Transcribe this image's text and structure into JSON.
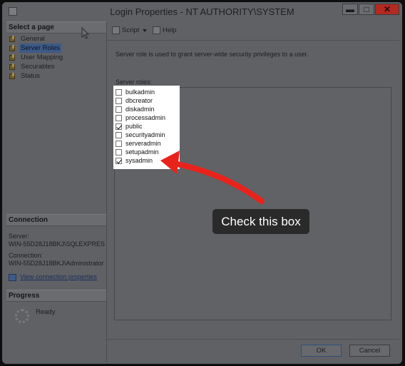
{
  "window": {
    "title": "Login Properties - NT AUTHORITY\\SYSTEM",
    "minimize_glyph": "▬",
    "maximize_glyph": "□",
    "close_glyph": "✕"
  },
  "left_pane": {
    "select_page_header": "Select a page",
    "pages": [
      {
        "label": "General",
        "icon": "wrench-icon"
      },
      {
        "label": "Server Roles",
        "icon": "wrench-icon",
        "selected": true
      },
      {
        "label": "User Mapping",
        "icon": "wrench-icon"
      },
      {
        "label": "Securables",
        "icon": "wrench-icon"
      },
      {
        "label": "Status",
        "icon": "wrench-icon"
      }
    ],
    "connection_header": "Connection",
    "server_label": "Server:",
    "server_value": "WIN-55D28J18BKJ\\SQLEXPRES",
    "connection_label": "Connection:",
    "connection_value": "WIN-55D28J18BKJ\\Administrator",
    "view_link": "View connection properties",
    "progress_header": "Progress",
    "progress_status": "Ready"
  },
  "toolbar": {
    "script_label": "Script",
    "help_label": "Help"
  },
  "main": {
    "description": "Server role is used to grant server-wide security privileges to a user.",
    "roles_label": "Server roles:",
    "roles": [
      {
        "name": "bulkadmin",
        "checked": false
      },
      {
        "name": "dbcreator",
        "checked": false
      },
      {
        "name": "diskadmin",
        "checked": false
      },
      {
        "name": "processadmin",
        "checked": false
      },
      {
        "name": "public",
        "checked": true
      },
      {
        "name": "securityadmin",
        "checked": false
      },
      {
        "name": "serveradmin",
        "checked": false
      },
      {
        "name": "setupadmin",
        "checked": false
      },
      {
        "name": "sysadmin",
        "checked": true
      }
    ]
  },
  "annotation": {
    "callout_text": "Check this box",
    "arrow_color": "#e8231c"
  },
  "buttons": {
    "ok": "OK",
    "cancel": "Cancel"
  }
}
